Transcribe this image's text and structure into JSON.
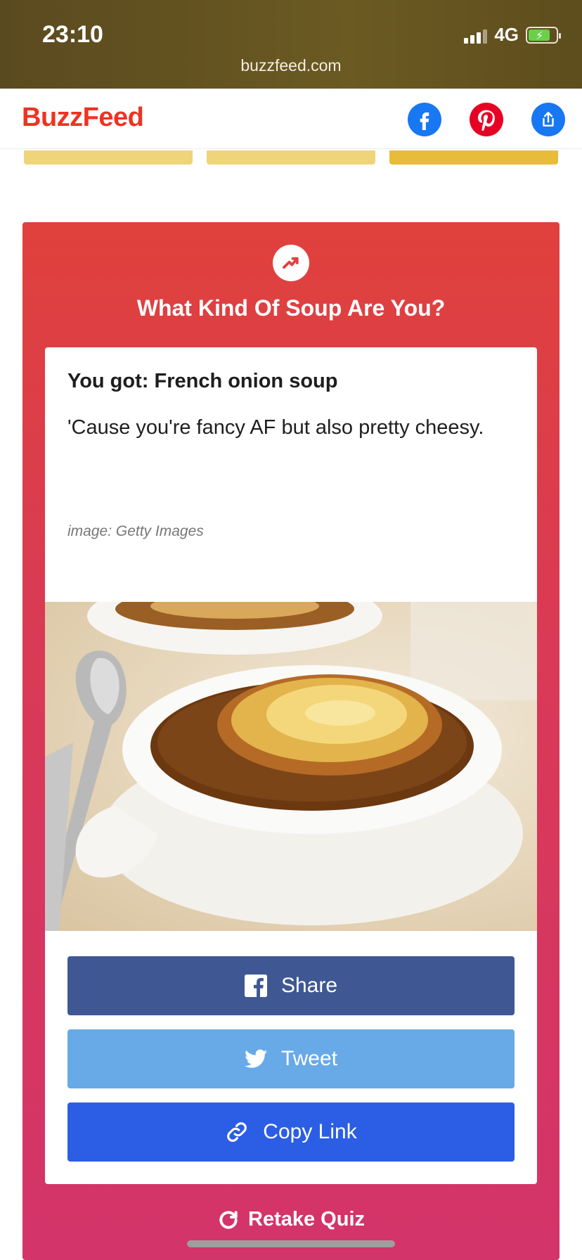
{
  "status_bar": {
    "time": "23:10",
    "network": "4G",
    "url": "buzzfeed.com"
  },
  "header": {
    "logo": "BuzzFeed",
    "share_icons": [
      "facebook-icon",
      "pinterest-icon",
      "share-icon"
    ]
  },
  "quiz": {
    "title": "What Kind Of Soup Are You?",
    "result_heading": "You got: French onion soup",
    "result_description": "'Cause you're fancy AF but also pretty cheesy.",
    "image_credit": "image: Getty Images",
    "buttons": {
      "share": "Share",
      "tweet": "Tweet",
      "copy_link": "Copy Link"
    },
    "retake": "Retake Quiz"
  },
  "colors": {
    "brand": "#ee3322",
    "quiz_bg_top": "#e0413c",
    "quiz_bg_bottom": "#d3346a",
    "facebook_button": "#3f5893",
    "twitter_button": "#68a9e8",
    "copy_link_button": "#2b5ee5"
  }
}
